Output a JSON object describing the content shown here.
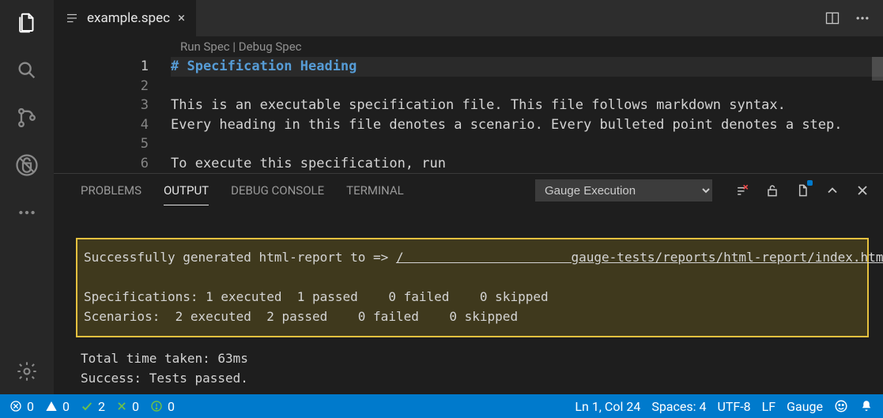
{
  "tab": {
    "filename": "example.spec",
    "close_glyph": "×"
  },
  "codelens": {
    "run": "Run Spec",
    "sep": " | ",
    "debug": "Debug Spec"
  },
  "editor": {
    "lines": [
      {
        "n": 1,
        "text": "# Specification Heading",
        "md_heading": true,
        "current": true
      },
      {
        "n": 2,
        "text": ""
      },
      {
        "n": 3,
        "text": "This is an executable specification file. This file follows markdown syntax."
      },
      {
        "n": 4,
        "text": "Every heading in this file denotes a scenario. Every bulleted point denotes a step."
      },
      {
        "n": 5,
        "text": ""
      },
      {
        "n": 6,
        "text": "To execute this specification, run"
      }
    ]
  },
  "panel": {
    "tabs": {
      "problems": "PROBLEMS",
      "output": "OUTPUT",
      "debug_console": "DEBUG CONSOLE",
      "terminal": "TERMINAL"
    },
    "select_value": "Gauge Execution",
    "output": {
      "line1_prefix": "Successfully generated html-report to => ",
      "line1_link": "/                      gauge-tests/reports/html-report/index.html",
      "spec_line": "Specifications: 1 executed  1 passed    0 failed    0 skipped",
      "scen_line": "Scenarios:  2 executed  2 passed    0 failed    0 skipped",
      "time_line": "Total time taken: 63ms",
      "success_line": "Success: Tests passed."
    }
  },
  "status": {
    "errors": "0",
    "warnings": "0",
    "git_ahead": "2",
    "git_behind": "0",
    "circle": "0",
    "cursor": "Ln 1, Col 24",
    "spaces": "Spaces: 4",
    "encoding": "UTF-8",
    "eol": "LF",
    "language": "Gauge"
  }
}
